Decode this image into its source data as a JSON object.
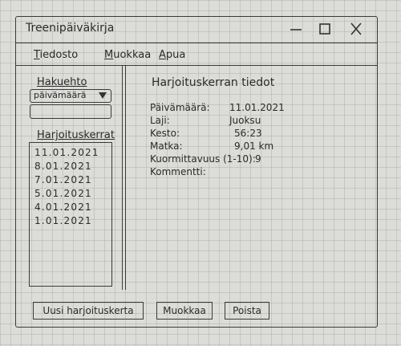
{
  "window": {
    "title": "Treenipäiväkirja"
  },
  "menu": {
    "items": [
      {
        "mnemonic": "T",
        "rest": "iedosto"
      },
      {
        "mnemonic": "M",
        "rest": "uokkaa"
      },
      {
        "mnemonic": "A",
        "rest": "pua"
      }
    ]
  },
  "search": {
    "label": "Hakuehto",
    "dropdown_value": "päivämäärä",
    "input_value": ""
  },
  "list": {
    "label": "Harjoituskerrat",
    "items": [
      "11.01.2021",
      "8.01.2021",
      "7.01.2021",
      "5.01.2021",
      "4.01.2021",
      "1.01.2021"
    ]
  },
  "details": {
    "title": "Harjoituskerran tiedot",
    "rows": [
      {
        "label": "Päivämäärä:",
        "value": "11.01.2021"
      },
      {
        "label": "Laji:",
        "value": "Juoksu"
      },
      {
        "label": "Kesto:",
        "value": "56:23"
      },
      {
        "label": "Matka:",
        "value": "9,01 km"
      },
      {
        "label": "Kuormittavuus (1-10):",
        "value": "9"
      },
      {
        "label": "Kommentti:",
        "value": ""
      }
    ]
  },
  "buttons": {
    "new": "Uusi harjoituskerta",
    "edit": "Muokkaa",
    "delete": "Poista"
  }
}
